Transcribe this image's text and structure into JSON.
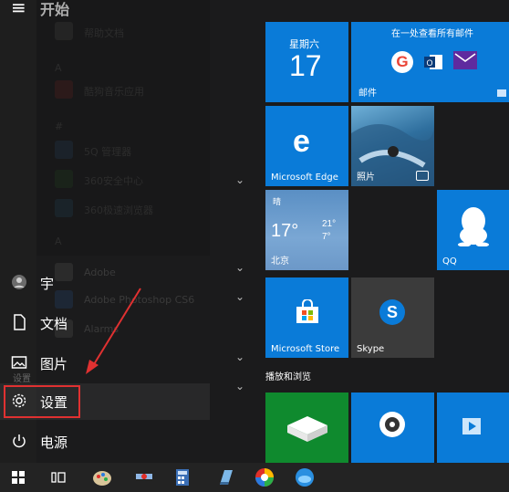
{
  "header": {
    "title": "开始"
  },
  "rail": [
    {
      "key": "user",
      "label": "宇",
      "icon": "user-avatar-icon"
    },
    {
      "key": "documents",
      "label": "文档",
      "icon": "document-icon"
    },
    {
      "key": "pictures",
      "label": "图片",
      "icon": "pictures-icon"
    },
    {
      "key": "settings",
      "label": "设置",
      "icon": "gear-icon"
    },
    {
      "key": "power",
      "label": "电源",
      "icon": "power-icon"
    }
  ],
  "faded_app_list": {
    "item1": "帮助文档",
    "item2": "酷狗音乐应用",
    "item3": "5Q 管理器",
    "item4": "360安全中心",
    "item5": "360极速浏览器",
    "item6": "Adobe",
    "item7": "Adobe Photoshop CS6",
    "item8": "Alarms",
    "settings_tooltip": "设置"
  },
  "tiles": {
    "calendar": {
      "weekday": "星期六",
      "day": "17"
    },
    "mail": {
      "header": "在一处查看所有邮件",
      "label": "邮件"
    },
    "edge": {
      "label": "Microsoft Edge"
    },
    "photos": {
      "label": "照片"
    },
    "weather": {
      "condition": "晴",
      "temp": "17°",
      "high": "21°",
      "low": "7°",
      "city": "北京"
    },
    "qq": {
      "label": "QQ"
    },
    "store": {
      "label": "Microsoft Store"
    },
    "skype": {
      "label": "Skype"
    },
    "section_label": "播放和浏览"
  },
  "colors": {
    "tile_blue": "#0a7bd8",
    "green_tile": "#0f8a2e",
    "gray_tile": "#3b3b3b",
    "highlight_red": "#e03131"
  }
}
